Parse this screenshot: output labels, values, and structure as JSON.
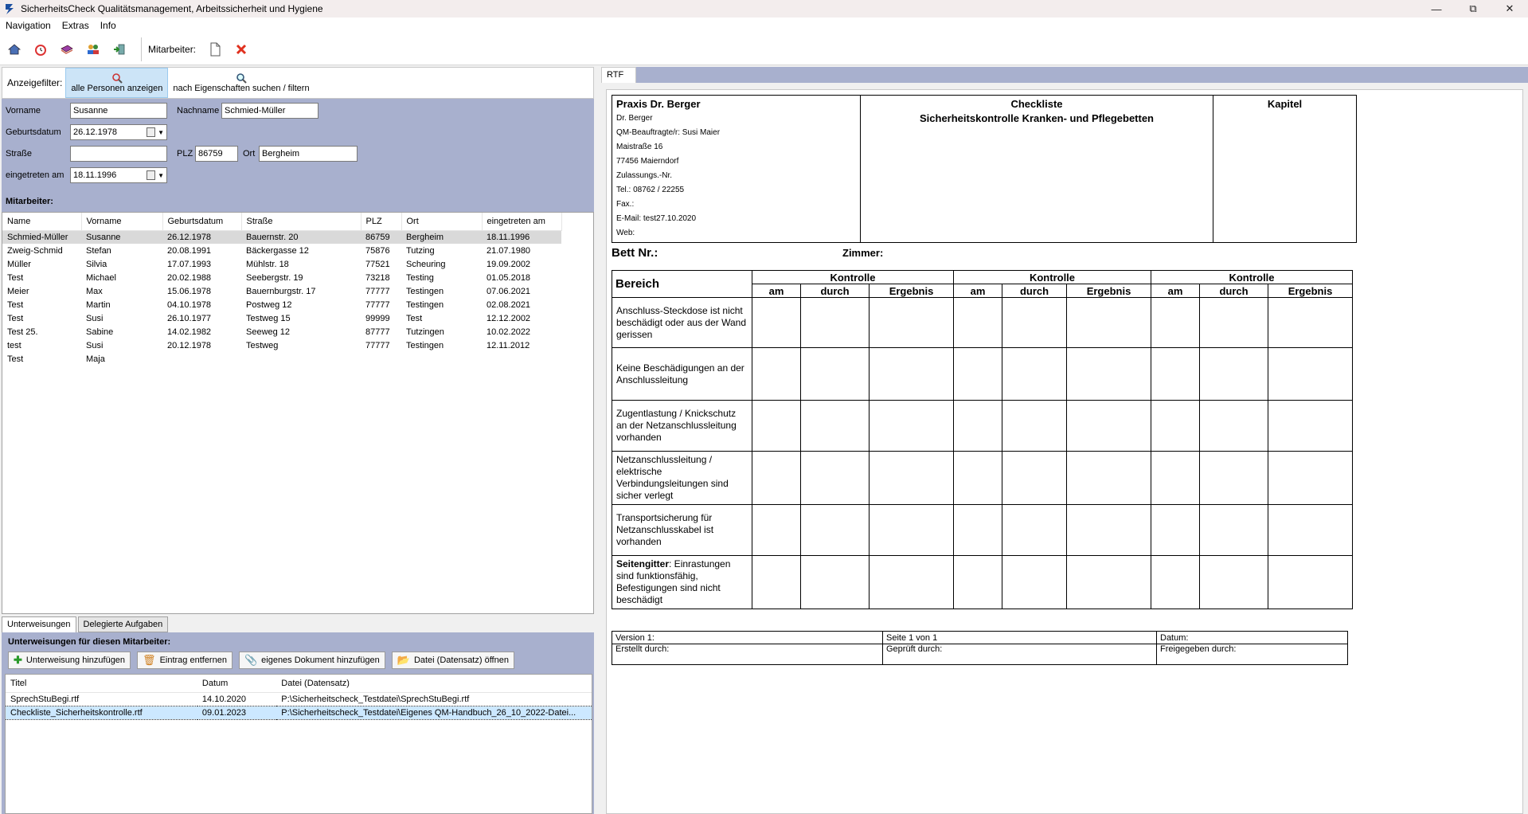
{
  "window": {
    "title": "SicherheitsCheck Qualitätsmanagement, Arbeitssicherheit und Hygiene"
  },
  "menu": [
    "Navigation",
    "Extras",
    "Info"
  ],
  "toolbar": {
    "mitarbeiter_label": "Mitarbeiter:"
  },
  "filter": {
    "label": "Anzeigefilter:",
    "btn_all": "alle Personen anzeigen",
    "btn_search": "nach Eigenschaften suchen / filtern"
  },
  "form": {
    "vorname_label": "Vorname",
    "vorname": "Susanne",
    "nachname_label": "Nachname",
    "nachname": "Schmied-Müller",
    "geburtsdatum_label": "Geburtsdatum",
    "geburtsdatum": "26.12.1978",
    "strasse_label": "Straße",
    "strasse": "",
    "plz_label": "PLZ",
    "plz": "86759",
    "ort_label": "Ort",
    "ort": "Bergheim",
    "eingetreten_label": "eingetreten am",
    "eingetreten": "18.11.1996",
    "section_label": "Mitarbeiter:"
  },
  "employees": {
    "columns": [
      "Name",
      "Vorname",
      "Geburtsdatum",
      "Straße",
      "PLZ",
      "Ort",
      "eingetreten am"
    ],
    "rows": [
      [
        "Schmied-Müller",
        "Susanne",
        "26.12.1978",
        "Bauernstr. 20",
        "86759",
        "Bergheim",
        "18.11.1996"
      ],
      [
        "Zweig-Schmid",
        "Stefan",
        "20.08.1991",
        "Bäckergasse 12",
        "75876",
        "Tutzing",
        "21.07.1980"
      ],
      [
        "Müller",
        "Silvia",
        "17.07.1993",
        "Mühlstr. 18",
        "77521",
        "Scheuring",
        "19.09.2002"
      ],
      [
        "Test",
        "Michael",
        "20.02.1988",
        "Seebergstr. 19",
        "73218",
        "Testing",
        "01.05.2018"
      ],
      [
        "Meier",
        "Max",
        "15.06.1978",
        "Bauernburgstr. 17",
        "77777",
        "Testingen",
        "07.06.2021"
      ],
      [
        "Test",
        "Martin",
        "04.10.1978",
        "Postweg 12",
        "77777",
        "Testingen",
        "02.08.2021"
      ],
      [
        "Test",
        "Susi",
        "26.10.1977",
        "Testweg 15",
        "99999",
        "Test",
        "12.12.2002"
      ],
      [
        "Test 25.",
        "Sabine",
        "14.02.1982",
        "Seeweg 12",
        "87777",
        "Tutzingen",
        "10.02.2022"
      ],
      [
        "test",
        "Susi",
        "20.12.1978",
        "Testweg",
        "77777",
        "Testingen",
        "12.11.2012"
      ],
      [
        "Test",
        "Maja",
        "",
        "",
        "",
        "",
        ""
      ]
    ]
  },
  "lower_tabs": [
    "Unterweisungen",
    "Delegierte Aufgaben"
  ],
  "unterweisungen": {
    "heading": "Unterweisungen für diesen Mitarbeiter:",
    "buttons": [
      "Unterweisung hinzufügen",
      "Eintrag entfernen",
      "eigenes Dokument hinzufügen",
      "Datei (Datensatz) öffnen"
    ],
    "columns": [
      "Titel",
      "Datum",
      "Datei (Datensatz)"
    ],
    "rows": [
      [
        "SprechStuBegi.rtf",
        "14.10.2020",
        "P:\\Sicherheitscheck_Testdatei\\SprechStuBegi.rtf"
      ],
      [
        "Checkliste_Sicherheitskontrolle.rtf",
        "09.01.2023",
        "P:\\Sicherheitscheck_Testdatei\\Eigenes QM-Handbuch_26_10_2022-Datei..."
      ]
    ]
  },
  "rtf": {
    "tab": "RTF",
    "praxis_name": "Praxis Dr. Berger",
    "praxis_lines": [
      "Dr. Berger",
      "QM-Beauftragte/r: Susi Maier",
      "Maistraße 16",
      "77456 Maierndorf",
      "Zulassungs.-Nr.",
      "Tel.: 08762 / 22255",
      "Fax.:",
      "E-Mail: test27.10.2020",
      "Web:"
    ],
    "checklist_title": "Checkliste",
    "checklist_subtitle": "Sicherheitskontrolle Kranken- und Pflegebetten",
    "kapitel": "Kapitel",
    "bett": "Bett Nr.:",
    "zimmer": "Zimmer:",
    "bereich": "Bereich",
    "kontrolle": "Kontrolle",
    "sub_cols": [
      "am",
      "durch",
      "Ergebnis"
    ],
    "items": [
      {
        "bold": "",
        "text": "Anschluss-Steckdose ist nicht beschädigt oder aus der Wand gerissen"
      },
      {
        "bold": "",
        "text": "Keine Beschädigungen an der Anschlussleitung"
      },
      {
        "bold": "",
        "text": "Zugentlastung / Knickschutz an der Netzanschlussleitung vorhanden"
      },
      {
        "bold": "",
        "text": "Netzanschlussleitung / elektrische Verbindungsleitungen sind sicher verlegt"
      },
      {
        "bold": "",
        "text": "Transportsicherung für Netzanschlusskabel ist vorhanden"
      },
      {
        "bold": "Seitengitter",
        "text": ": Einrastungen sind funktionsfähig, Befestigungen sind nicht beschädigt"
      }
    ],
    "footer": {
      "version": "Version 1:",
      "seite": "Seite 1 von 1",
      "datum": "Datum:",
      "erstellt": "Erstellt durch:",
      "geprueft": "Geprüft durch:",
      "freigegeben": "Freigegeben durch:"
    }
  }
}
